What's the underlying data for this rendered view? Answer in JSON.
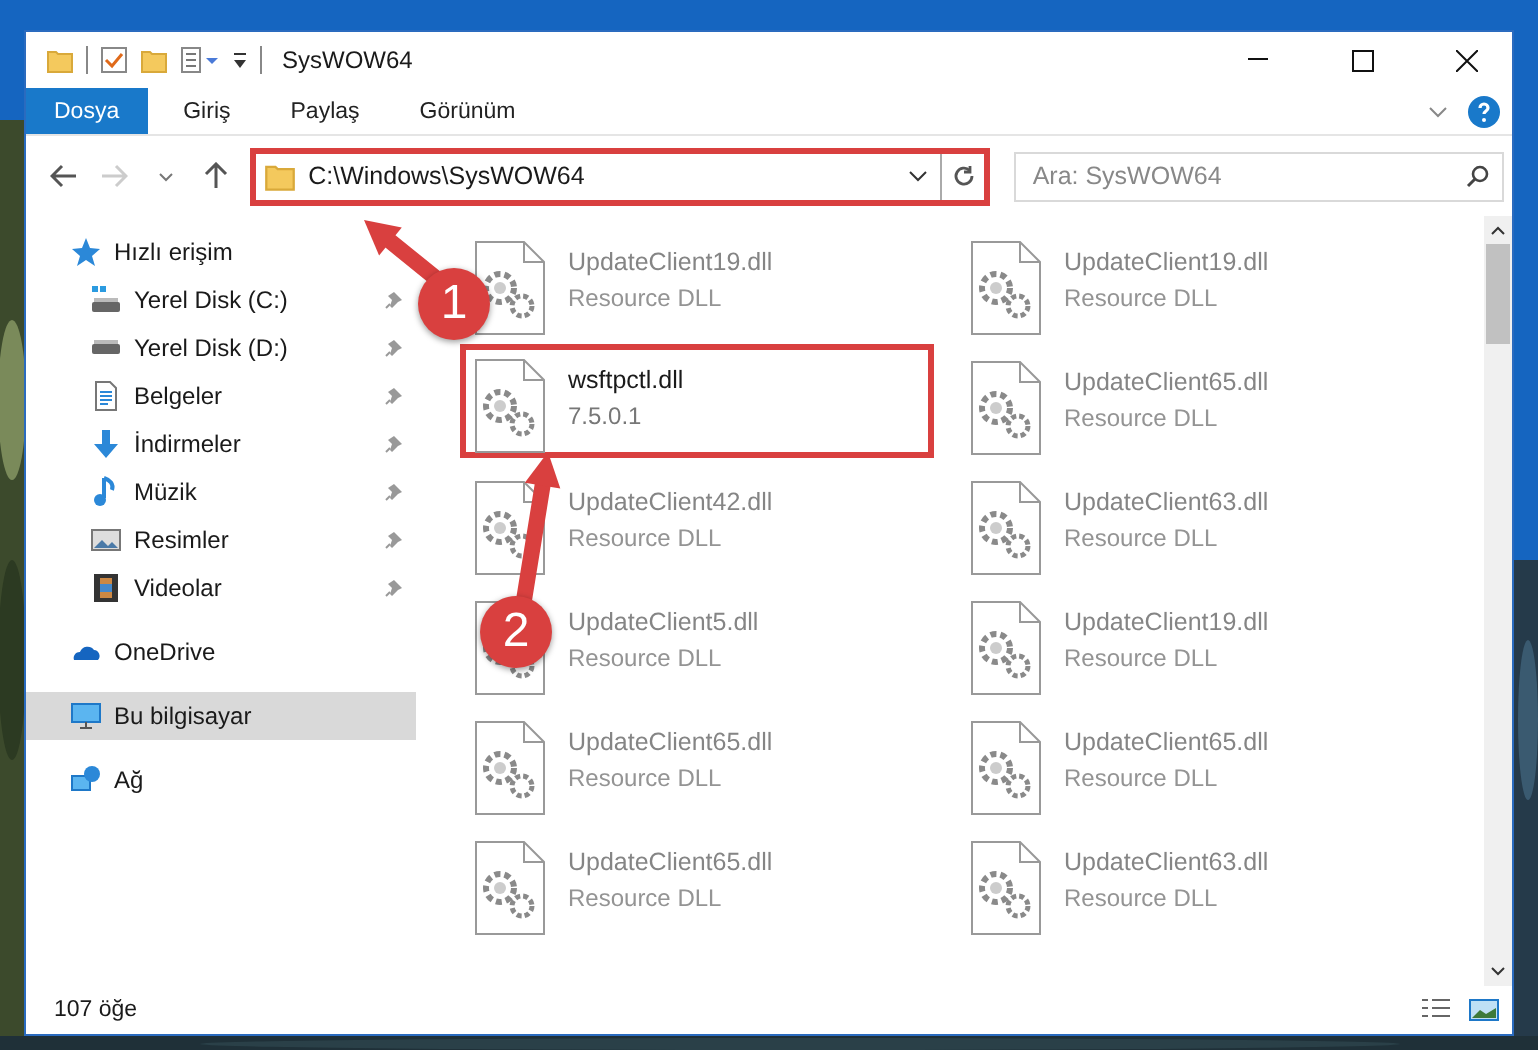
{
  "window": {
    "title": "SysWOW64"
  },
  "ribbon_tabs": [
    {
      "label": "Dosya",
      "selected": true
    },
    {
      "label": "Giriş",
      "selected": false
    },
    {
      "label": "Paylaş",
      "selected": false
    },
    {
      "label": "Görünüm",
      "selected": false
    }
  ],
  "address": {
    "path": "C:\\Windows\\SysWOW64",
    "highlighted": true
  },
  "search": {
    "placeholder": "Ara: SysWOW64"
  },
  "sidebar": {
    "items": [
      {
        "label": "Hızlı erişim",
        "kind": "quick",
        "selected": false,
        "children": [
          {
            "label": "Yerel Disk (C:)",
            "kind": "drive-c",
            "pinned": true,
            "selected": false
          },
          {
            "label": "Yerel Disk (D:)",
            "kind": "drive-d",
            "pinned": true,
            "selected": false
          },
          {
            "label": "Belgeler",
            "kind": "documents",
            "pinned": true,
            "selected": false
          },
          {
            "label": "İndirmeler",
            "kind": "downloads",
            "pinned": true,
            "selected": false
          },
          {
            "label": "Müzik",
            "kind": "music",
            "pinned": true,
            "selected": false
          },
          {
            "label": "Resimler",
            "kind": "pictures",
            "pinned": true,
            "selected": false
          },
          {
            "label": "Videolar",
            "kind": "videos",
            "pinned": true,
            "selected": false
          }
        ]
      },
      {
        "label": "OneDrive",
        "kind": "onedrive",
        "selected": false
      },
      {
        "label": "Bu bilgisayar",
        "kind": "pc",
        "selected": true
      },
      {
        "label": "Ağ",
        "kind": "network",
        "selected": false
      }
    ]
  },
  "files": [
    {
      "name": "UpdateClient19.dll",
      "detail": "Resource DLL",
      "highlighted": false
    },
    {
      "name": "UpdateClient19.dll",
      "detail": "Resource DLL",
      "highlighted": false
    },
    {
      "name": "wsftpctl.dll",
      "detail": "7.5.0.1",
      "highlighted": true
    },
    {
      "name": "UpdateClient65.dll",
      "detail": "Resource DLL",
      "highlighted": false
    },
    {
      "name": "UpdateClient42.dll",
      "detail": "Resource DLL",
      "highlighted": false
    },
    {
      "name": "UpdateClient63.dll",
      "detail": "Resource DLL",
      "highlighted": false
    },
    {
      "name": "UpdateClient5.dll",
      "detail": "Resource DLL",
      "highlighted": false
    },
    {
      "name": "UpdateClient19.dll",
      "detail": "Resource DLL",
      "highlighted": false
    },
    {
      "name": "UpdateClient65.dll",
      "detail": "Resource DLL",
      "highlighted": false
    },
    {
      "name": "UpdateClient65.dll",
      "detail": "Resource DLL",
      "highlighted": false
    },
    {
      "name": "UpdateClient65.dll",
      "detail": "Resource DLL",
      "highlighted": false
    },
    {
      "name": "UpdateClient63.dll",
      "detail": "Resource DLL",
      "highlighted": false
    }
  ],
  "annotations": [
    {
      "number": "1"
    },
    {
      "number": "2"
    }
  ],
  "status_bar": {
    "count": "107 öğe"
  }
}
